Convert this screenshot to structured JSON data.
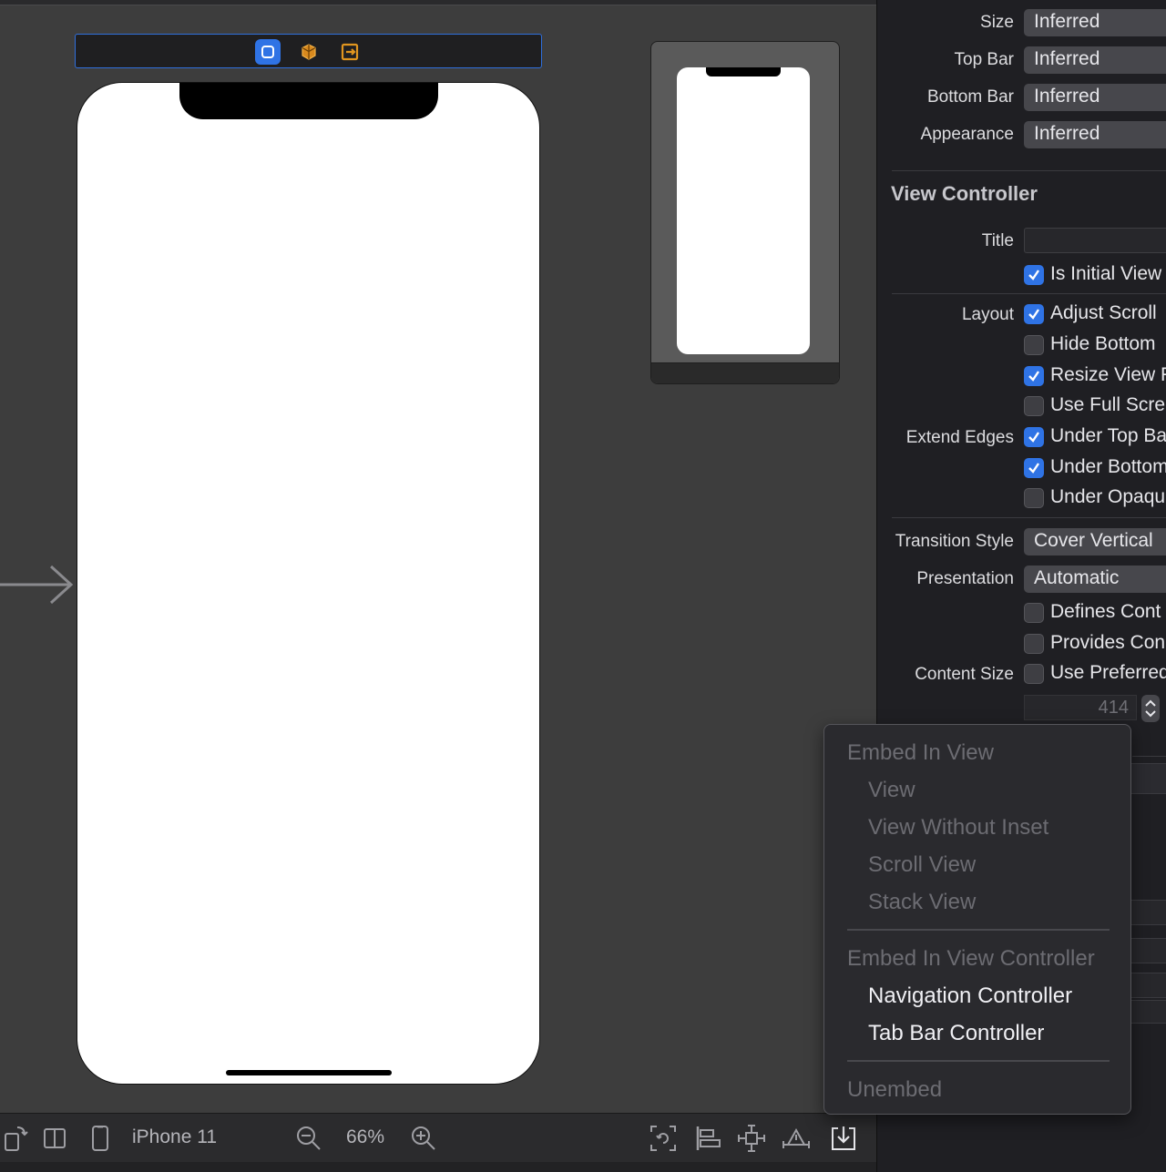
{
  "inspector": {
    "simulated_metrics": [
      {
        "label": "Size",
        "value": "Inferred"
      },
      {
        "label": "Top Bar",
        "value": "Inferred"
      },
      {
        "label": "Bottom Bar",
        "value": "Inferred"
      },
      {
        "label": "Appearance",
        "value": "Inferred"
      }
    ],
    "section_title": "View Controller",
    "title_label": "Title",
    "title_value": "",
    "is_initial": {
      "label": "Is Initial View",
      "checked": true
    },
    "layout_label": "Layout",
    "layout_options": [
      {
        "label": "Adjust Scroll",
        "checked": true
      },
      {
        "label": "Hide Bottom",
        "checked": false
      },
      {
        "label": "Resize View F",
        "checked": true
      },
      {
        "label": "Use Full Scre",
        "checked": false
      }
    ],
    "extend_edges_label": "Extend Edges",
    "extend_edges_options": [
      {
        "label": "Under Top Ba",
        "checked": true
      },
      {
        "label": "Under Bottom",
        "checked": true
      },
      {
        "label": "Under Opaqu",
        "checked": false
      }
    ],
    "transition_style": {
      "label": "Transition Style",
      "value": "Cover Vertical"
    },
    "presentation": {
      "label": "Presentation",
      "value": "Automatic"
    },
    "presentation_options": [
      {
        "label": "Defines Cont",
        "checked": false
      },
      {
        "label": "Provides Con",
        "checked": false
      }
    ],
    "content_size": {
      "label": "Content Size",
      "option_label": "Use Preferred",
      "checked": false,
      "width_value": "414"
    }
  },
  "context_menu": {
    "embed_in_view": {
      "header": "Embed In View",
      "items": [
        {
          "label": "View",
          "enabled": false
        },
        {
          "label": "View Without Inset",
          "enabled": false
        },
        {
          "label": "Scroll View",
          "enabled": false
        },
        {
          "label": "Stack View",
          "enabled": false
        }
      ]
    },
    "embed_in_view_controller": {
      "header": "Embed In View Controller",
      "items": [
        {
          "label": "Navigation Controller",
          "enabled": true
        },
        {
          "label": "Tab Bar Controller",
          "enabled": true
        }
      ]
    },
    "unembed": "Unembed"
  },
  "bottombar": {
    "device": "iPhone 11",
    "zoom": "66%"
  },
  "scene_bar": {
    "icons": [
      "view-controller-icon",
      "first-responder-icon",
      "exit-icon"
    ]
  },
  "colors": {
    "accent": "#2f73e5",
    "selection_border": "#2f6fdc",
    "canvas": "#3d3d3d",
    "inspector_bg": "#1f1f23"
  }
}
